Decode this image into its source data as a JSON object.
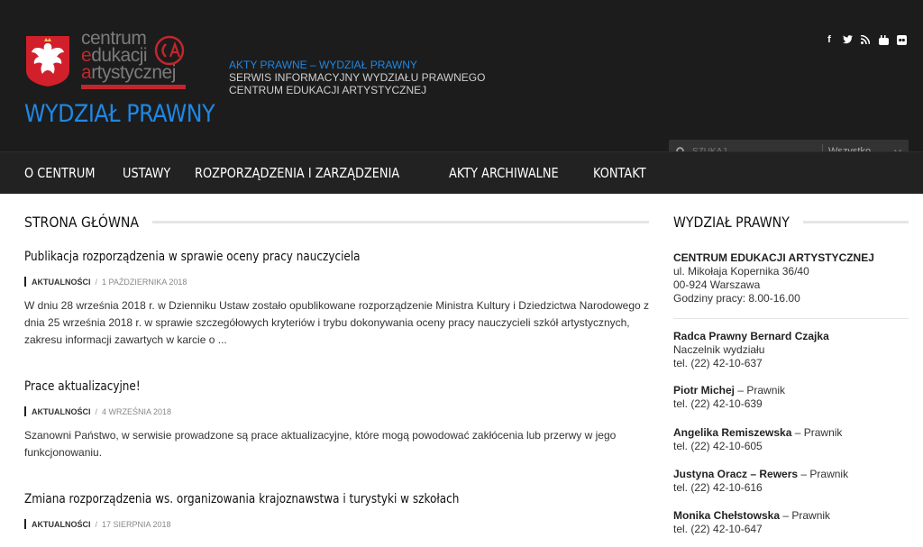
{
  "header": {
    "logo_line1": "centrum",
    "logo_line2_first": "e",
    "logo_line2_rest": "dukacji",
    "logo_line3_first": "a",
    "logo_line3_rest": "rtystycznej",
    "site_title": "WYDZIAŁ PRAWNY",
    "tagline1": "AKTY PRAWNE – WYDZIAŁ PRAWNY",
    "tagline2": "SERWIS INFORMACYJNY WYDZIAŁU PRAWNEGO",
    "tagline3": "CENTRUM EDUKACJI ARTYSTYCZNEJ",
    "social": [
      "facebook-icon",
      "twitter-icon",
      "rss-icon",
      "youtube-icon",
      "flickr-icon"
    ],
    "search_placeholder": "SZUKAJ...",
    "search_scope": "Wszystko"
  },
  "nav": [
    "O CENTRUM",
    "USTAWY",
    "ROZPORZĄDZENIA I ZARZĄDZENIA",
    "AKTY ARCHIWALNE",
    "KONTAKT"
  ],
  "main": {
    "heading": "STRONA GŁÓWNA",
    "posts": [
      {
        "title": "Publikacja rozporządzenia w sprawie oceny pracy nauczyciela",
        "category": "AKTUALNOŚCI",
        "date": "1 PAŹDZIERNIKA 2018",
        "excerpt": "W dniu 28 września 2018 r. w Dzienniku Ustaw zostało opublikowane rozporządzenie Ministra Kultury i Dziedzictwa Narodowego z dnia 25 września 2018 r. w sprawie szczegółowych kryteriów i trybu dokonywania oceny pracy nauczycieli szkół artystycznych, zakresu informacji zawartych w karcie o ..."
      },
      {
        "title": "Prace aktualizacyjne!",
        "category": "AKTUALNOŚCI",
        "date": "4 WRZEŚNIA 2018",
        "excerpt": "Szanowni Państwo, w serwisie prowadzone są prace aktualizacyjne, które mogą powodować zakłócenia lub przerwy w jego funkcjonowaniu."
      },
      {
        "title": "Zmiana rozporządzenia ws. organizowania krajoznawstwa i turystyki w szkołach",
        "category": "AKTUALNOŚCI",
        "date": "17 SIERPNIA 2018",
        "excerpt": ""
      }
    ]
  },
  "sidebar": {
    "heading": "WYDZIAŁ PRAWNY",
    "org": "CENTRUM EDUKACJI ARTYSTYCZNEJ",
    "address1": "ul. Mikołaja Kopernika 36/40",
    "address2": "00-924 Warszawa",
    "hours": "Godziny pracy: 8.00-16.00",
    "staff": [
      {
        "name": "Radca Prawny Bernard Czajka",
        "role": "",
        "role2": "Naczelnik wydziału",
        "phone": "tel. (22) 42-10-637"
      },
      {
        "name": "Piotr Michej",
        "role": " – Prawnik",
        "role2": "",
        "phone": "tel. (22) 42-10-639"
      },
      {
        "name": "Angelika Remiszewska",
        "role": " – Prawnik",
        "role2": "",
        "phone": "tel. (22) 42-10-605"
      },
      {
        "name": "Justyna Oracz – Rewers",
        "role": " – Prawnik",
        "role2": "",
        "phone": "tel. (22) 42-10-616"
      },
      {
        "name": "Monika Chełstowska",
        "role": " – Prawnik",
        "role2": "",
        "phone": "tel. (22) 42-10-647"
      }
    ]
  },
  "colors": {
    "accent": "#1e88e5",
    "brand_red": "#c0272d",
    "header_bg": "#1c1c1c"
  }
}
